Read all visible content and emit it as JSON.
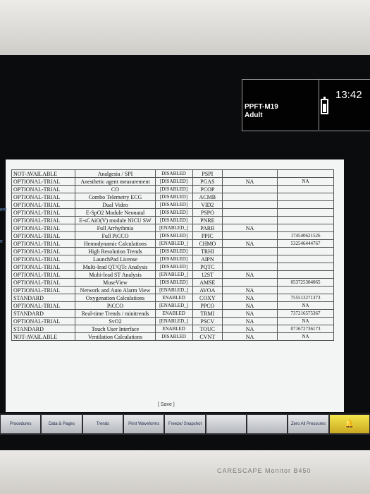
{
  "header": {
    "device_id": "PPFT-M19",
    "patient_mode": "Adult",
    "time": "13:42"
  },
  "side_fragments": [
    "ent",
    "e"
  ],
  "table_rows": [
    [
      "NOT-AVAILABLE",
      "Analgesia / SPI",
      "DISABLED",
      "PSPI",
      "",
      ""
    ],
    [
      "OPTIONAL-TRIAL",
      "Anesthetic agent measurement",
      "[DISABLED]",
      "PGAS",
      "NA",
      "NA"
    ],
    [
      "OPTIONAL-TRIAL",
      "CO",
      "[DISABLED]",
      "PCOP",
      "",
      ""
    ],
    [
      "OPTIONAL-TRIAL",
      "Combo Telemetry ECG",
      "[DISABLED]",
      "ACMB",
      "",
      ""
    ],
    [
      "OPTIONAL-TRIAL",
      "Dual Video",
      "[DISABLED]",
      "VID2",
      "",
      ""
    ],
    [
      "OPTIONAL-TRIAL",
      "E-SpO2 Module Neonatal",
      "[DISABLED]",
      "PSPO",
      "",
      ""
    ],
    [
      "OPTIONAL-TRIAL",
      "E-sCAiO(V) module NICU SW",
      "[DISABLED]",
      "PNRE",
      "",
      ""
    ],
    [
      "OPTIONAL-TRIAL",
      "Full Arrhythmia",
      "[ENABLED_]",
      "PARR",
      "NA",
      ""
    ],
    [
      "OPTIONAL-TRIAL",
      "Full PiCCO",
      "[DISABLED]",
      "PPIC",
      "",
      "174540621526"
    ],
    [
      "OPTIONAL-TRIAL",
      "Hemodynamic Calculations",
      "[ENABLED_]",
      "CHMO",
      "NA",
      "532546444767"
    ],
    [
      "OPTIONAL-TRIAL",
      "High Resolution Trends",
      "[DISABLED]",
      "TRHI",
      "",
      ""
    ],
    [
      "OPTIONAL-TRIAL",
      "LaunchPad License",
      "[DISABLED]",
      "AIPN",
      "",
      ""
    ],
    [
      "OPTIONAL-TRIAL",
      "Multi-lead QT/QTc Analysis",
      "[DISABLED]",
      "PQTC",
      "",
      ""
    ],
    [
      "OPTIONAL-TRIAL",
      "Multi-lead ST Analysis",
      "[ENABLED_]",
      "12ST",
      "NA",
      ""
    ],
    [
      "OPTIONAL-TRIAL",
      "MuseView",
      "[DISABLED]",
      "AMSE",
      "",
      "053725304065"
    ],
    [
      "OPTIONAL-TRIAL",
      "Network and Auto Alarm View",
      "[ENABLED_]",
      "AVOA",
      "NA",
      ""
    ],
    [
      "STANDARD",
      "Oxygenation Calculations",
      "ENABLED",
      "COXY",
      "NA",
      "755513271373"
    ],
    [
      "OPTIONAL-TRIAL",
      "PiCCO",
      "[ENABLED_]",
      "PPCO",
      "NA",
      "NA"
    ],
    [
      "STANDARD",
      "Real-time Trends / minitrends",
      "ENABLED",
      "TRMI",
      "NA",
      "737216575367"
    ],
    [
      "OPTIONAL-TRIAL",
      "SvO2",
      "[ENABLED_]",
      "PSCV",
      "NA",
      "NA"
    ],
    [
      "STANDARD",
      "Touch User Interface",
      "ENABLED",
      "TOUC",
      "NA",
      "071672736173"
    ],
    [
      "NOT-AVAILABLE",
      "Ventilation Calculations",
      "DISABLED",
      "CVNT",
      "NA",
      "NA"
    ]
  ],
  "save_label": "[ Save ]",
  "toolbar": [
    "Procedures",
    "Data & Pages",
    "Trends",
    "Print Waveforms",
    "Freeze/ Snapshot",
    "",
    "",
    "Zero All Pressures",
    "🔔"
  ],
  "brand": "CARESCAPE Monitor B450"
}
